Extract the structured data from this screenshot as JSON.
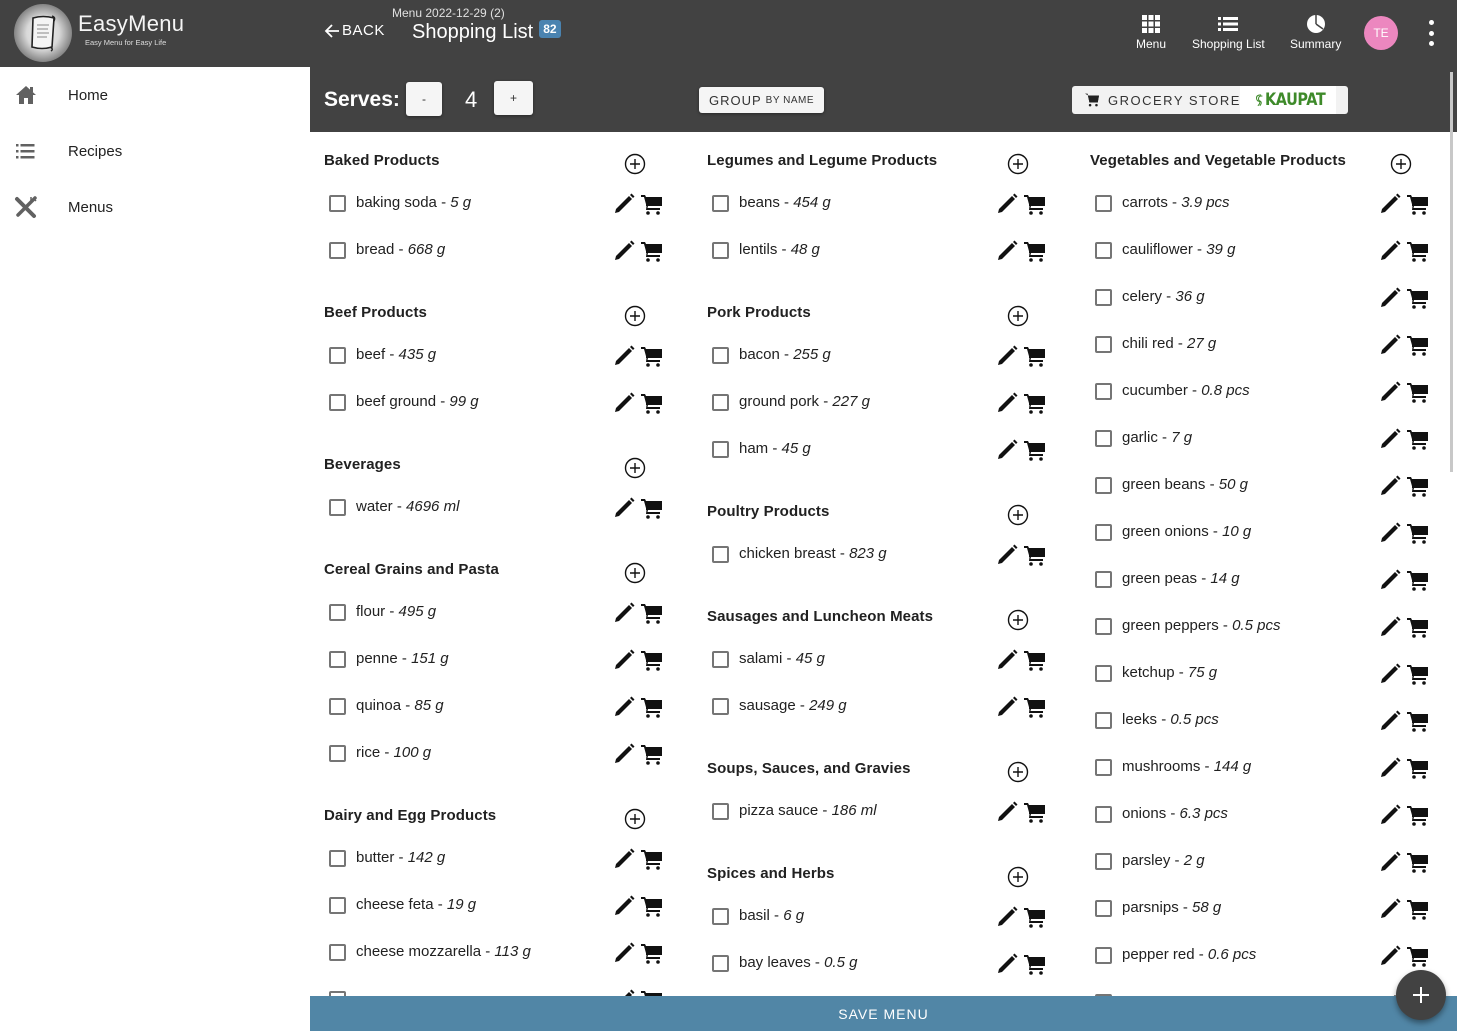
{
  "app": {
    "name": "EasyMenu",
    "tagline": "Easy Menu for Easy Life"
  },
  "header": {
    "back_label": "BACK",
    "subtitle": "Menu 2022-12-29 (2)",
    "title": "Shopping List",
    "badge_count": "82",
    "nav": [
      {
        "label": "Menu",
        "icon": "grid-icon"
      },
      {
        "label": "Shopping List",
        "icon": "list-icon"
      },
      {
        "label": "Summary",
        "icon": "pie-chart-icon"
      }
    ],
    "avatar_initials": "TE",
    "avatar_color": "#ec87bf"
  },
  "sidebar": {
    "items": [
      {
        "label": "Home",
        "icon": "home-icon"
      },
      {
        "label": "Recipes",
        "icon": "list-icon"
      },
      {
        "label": "Menus",
        "icon": "utensils-icon"
      }
    ]
  },
  "toolbar": {
    "serves_label": "Serves:",
    "serves_value": "4",
    "minus_label": "-",
    "plus_label": "+",
    "group_label": "GROUP",
    "group_sub": "BY NAME",
    "store_label": "GROCERY STORE:",
    "store_name": "KAUPAT"
  },
  "columns": [
    [
      {
        "name": "Baked Products",
        "items": [
          {
            "name": "baking soda",
            "qty": "5 g"
          },
          {
            "name": "bread",
            "qty": "668 g"
          }
        ]
      },
      {
        "name": "Beef Products",
        "items": [
          {
            "name": "beef",
            "qty": "435 g"
          },
          {
            "name": "beef ground",
            "qty": "99 g"
          }
        ]
      },
      {
        "name": "Beverages",
        "items": [
          {
            "name": "water",
            "qty": "4696 ml"
          }
        ]
      },
      {
        "name": "Cereal Grains and Pasta",
        "items": [
          {
            "name": "flour",
            "qty": "495 g"
          },
          {
            "name": "penne",
            "qty": "151 g"
          },
          {
            "name": "quinoa",
            "qty": "85 g"
          },
          {
            "name": "rice",
            "qty": "100 g"
          }
        ]
      },
      {
        "name": "Dairy and Egg Products",
        "items": [
          {
            "name": "butter",
            "qty": "142 g"
          },
          {
            "name": "cheese feta",
            "qty": "19 g"
          },
          {
            "name": "cheese mozzarella",
            "qty": "113 g"
          },
          {
            "name": "",
            "qty": ""
          }
        ]
      }
    ],
    [
      {
        "name": "Legumes and Legume Products",
        "items": [
          {
            "name": "beans",
            "qty": "454 g"
          },
          {
            "name": "lentils",
            "qty": "48 g"
          }
        ]
      },
      {
        "name": "Pork Products",
        "items": [
          {
            "name": "bacon",
            "qty": "255 g"
          },
          {
            "name": "ground pork",
            "qty": "227 g"
          },
          {
            "name": "ham",
            "qty": "45 g"
          }
        ]
      },
      {
        "name": "Poultry Products",
        "items": [
          {
            "name": "chicken breast",
            "qty": "823 g"
          }
        ]
      },
      {
        "name": "Sausages and Luncheon Meats",
        "items": [
          {
            "name": "salami",
            "qty": "45 g"
          },
          {
            "name": "sausage",
            "qty": "249 g"
          }
        ]
      },
      {
        "name": "Soups, Sauces, and Gravies",
        "items": [
          {
            "name": "pizza sauce",
            "qty": "186 ml"
          }
        ]
      },
      {
        "name": "Spices and Herbs",
        "items": [
          {
            "name": "basil",
            "qty": "6 g"
          },
          {
            "name": "bay leaves",
            "qty": "0.5 g"
          },
          {
            "name": "",
            "qty": ""
          }
        ]
      }
    ],
    [
      {
        "name": "Vegetables and Vegetable Products",
        "items": [
          {
            "name": "carrots",
            "qty": "3.9 pcs"
          },
          {
            "name": "cauliflower",
            "qty": "39 g"
          },
          {
            "name": "celery",
            "qty": "36 g"
          },
          {
            "name": "chili red",
            "qty": "27 g"
          },
          {
            "name": "cucumber",
            "qty": "0.8 pcs"
          },
          {
            "name": "garlic",
            "qty": "7 g"
          },
          {
            "name": "green beans",
            "qty": "50 g"
          },
          {
            "name": "green onions",
            "qty": "10 g"
          },
          {
            "name": "green peas",
            "qty": "14 g"
          },
          {
            "name": "green peppers",
            "qty": "0.5 pcs"
          },
          {
            "name": "ketchup",
            "qty": "75 g"
          },
          {
            "name": "leeks",
            "qty": "0.5 pcs"
          },
          {
            "name": "mushrooms",
            "qty": "144 g"
          },
          {
            "name": "onions",
            "qty": "6.3 pcs"
          },
          {
            "name": "parsley",
            "qty": "2 g"
          },
          {
            "name": "parsnips",
            "qty": "58 g"
          },
          {
            "name": "pepper red",
            "qty": "0.6 pcs"
          },
          {
            "name": "",
            "qty": ""
          }
        ]
      }
    ]
  ],
  "footer": {
    "save_label": "SAVE MENU"
  },
  "colors": {
    "topbar": "#424242",
    "save_bar": "#5186a6",
    "badge": "#4a83b0",
    "store_brand": "#3e8a2a"
  }
}
